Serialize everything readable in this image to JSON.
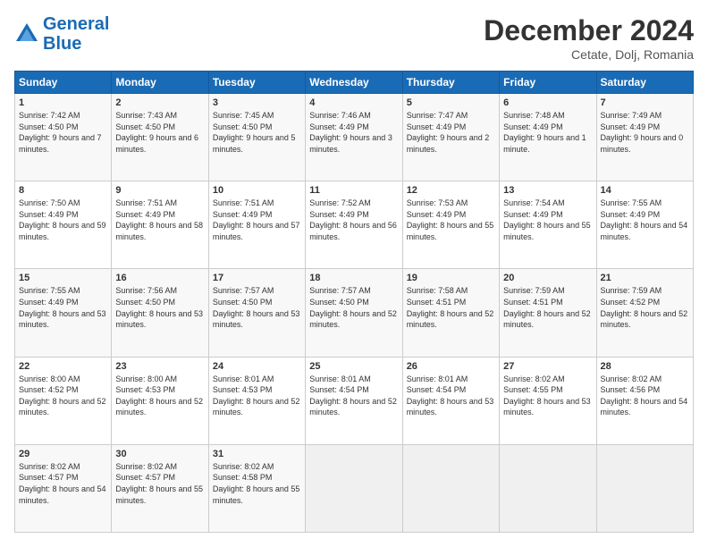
{
  "header": {
    "logo_line1": "General",
    "logo_line2": "Blue",
    "month_year": "December 2024",
    "location": "Cetate, Dolj, Romania"
  },
  "columns": [
    "Sunday",
    "Monday",
    "Tuesday",
    "Wednesday",
    "Thursday",
    "Friday",
    "Saturday"
  ],
  "weeks": [
    [
      {
        "day": "1",
        "sunrise": "Sunrise: 7:42 AM",
        "sunset": "Sunset: 4:50 PM",
        "daylight": "Daylight: 9 hours and 7 minutes."
      },
      {
        "day": "2",
        "sunrise": "Sunrise: 7:43 AM",
        "sunset": "Sunset: 4:50 PM",
        "daylight": "Daylight: 9 hours and 6 minutes."
      },
      {
        "day": "3",
        "sunrise": "Sunrise: 7:45 AM",
        "sunset": "Sunset: 4:50 PM",
        "daylight": "Daylight: 9 hours and 5 minutes."
      },
      {
        "day": "4",
        "sunrise": "Sunrise: 7:46 AM",
        "sunset": "Sunset: 4:49 PM",
        "daylight": "Daylight: 9 hours and 3 minutes."
      },
      {
        "day": "5",
        "sunrise": "Sunrise: 7:47 AM",
        "sunset": "Sunset: 4:49 PM",
        "daylight": "Daylight: 9 hours and 2 minutes."
      },
      {
        "day": "6",
        "sunrise": "Sunrise: 7:48 AM",
        "sunset": "Sunset: 4:49 PM",
        "daylight": "Daylight: 9 hours and 1 minute."
      },
      {
        "day": "7",
        "sunrise": "Sunrise: 7:49 AM",
        "sunset": "Sunset: 4:49 PM",
        "daylight": "Daylight: 9 hours and 0 minutes."
      }
    ],
    [
      {
        "day": "8",
        "sunrise": "Sunrise: 7:50 AM",
        "sunset": "Sunset: 4:49 PM",
        "daylight": "Daylight: 8 hours and 59 minutes."
      },
      {
        "day": "9",
        "sunrise": "Sunrise: 7:51 AM",
        "sunset": "Sunset: 4:49 PM",
        "daylight": "Daylight: 8 hours and 58 minutes."
      },
      {
        "day": "10",
        "sunrise": "Sunrise: 7:51 AM",
        "sunset": "Sunset: 4:49 PM",
        "daylight": "Daylight: 8 hours and 57 minutes."
      },
      {
        "day": "11",
        "sunrise": "Sunrise: 7:52 AM",
        "sunset": "Sunset: 4:49 PM",
        "daylight": "Daylight: 8 hours and 56 minutes."
      },
      {
        "day": "12",
        "sunrise": "Sunrise: 7:53 AM",
        "sunset": "Sunset: 4:49 PM",
        "daylight": "Daylight: 8 hours and 55 minutes."
      },
      {
        "day": "13",
        "sunrise": "Sunrise: 7:54 AM",
        "sunset": "Sunset: 4:49 PM",
        "daylight": "Daylight: 8 hours and 55 minutes."
      },
      {
        "day": "14",
        "sunrise": "Sunrise: 7:55 AM",
        "sunset": "Sunset: 4:49 PM",
        "daylight": "Daylight: 8 hours and 54 minutes."
      }
    ],
    [
      {
        "day": "15",
        "sunrise": "Sunrise: 7:55 AM",
        "sunset": "Sunset: 4:49 PM",
        "daylight": "Daylight: 8 hours and 53 minutes."
      },
      {
        "day": "16",
        "sunrise": "Sunrise: 7:56 AM",
        "sunset": "Sunset: 4:50 PM",
        "daylight": "Daylight: 8 hours and 53 minutes."
      },
      {
        "day": "17",
        "sunrise": "Sunrise: 7:57 AM",
        "sunset": "Sunset: 4:50 PM",
        "daylight": "Daylight: 8 hours and 53 minutes."
      },
      {
        "day": "18",
        "sunrise": "Sunrise: 7:57 AM",
        "sunset": "Sunset: 4:50 PM",
        "daylight": "Daylight: 8 hours and 52 minutes."
      },
      {
        "day": "19",
        "sunrise": "Sunrise: 7:58 AM",
        "sunset": "Sunset: 4:51 PM",
        "daylight": "Daylight: 8 hours and 52 minutes."
      },
      {
        "day": "20",
        "sunrise": "Sunrise: 7:59 AM",
        "sunset": "Sunset: 4:51 PM",
        "daylight": "Daylight: 8 hours and 52 minutes."
      },
      {
        "day": "21",
        "sunrise": "Sunrise: 7:59 AM",
        "sunset": "Sunset: 4:52 PM",
        "daylight": "Daylight: 8 hours and 52 minutes."
      }
    ],
    [
      {
        "day": "22",
        "sunrise": "Sunrise: 8:00 AM",
        "sunset": "Sunset: 4:52 PM",
        "daylight": "Daylight: 8 hours and 52 minutes."
      },
      {
        "day": "23",
        "sunrise": "Sunrise: 8:00 AM",
        "sunset": "Sunset: 4:53 PM",
        "daylight": "Daylight: 8 hours and 52 minutes."
      },
      {
        "day": "24",
        "sunrise": "Sunrise: 8:01 AM",
        "sunset": "Sunset: 4:53 PM",
        "daylight": "Daylight: 8 hours and 52 minutes."
      },
      {
        "day": "25",
        "sunrise": "Sunrise: 8:01 AM",
        "sunset": "Sunset: 4:54 PM",
        "daylight": "Daylight: 8 hours and 52 minutes."
      },
      {
        "day": "26",
        "sunrise": "Sunrise: 8:01 AM",
        "sunset": "Sunset: 4:54 PM",
        "daylight": "Daylight: 8 hours and 53 minutes."
      },
      {
        "day": "27",
        "sunrise": "Sunrise: 8:02 AM",
        "sunset": "Sunset: 4:55 PM",
        "daylight": "Daylight: 8 hours and 53 minutes."
      },
      {
        "day": "28",
        "sunrise": "Sunrise: 8:02 AM",
        "sunset": "Sunset: 4:56 PM",
        "daylight": "Daylight: 8 hours and 54 minutes."
      }
    ],
    [
      {
        "day": "29",
        "sunrise": "Sunrise: 8:02 AM",
        "sunset": "Sunset: 4:57 PM",
        "daylight": "Daylight: 8 hours and 54 minutes."
      },
      {
        "day": "30",
        "sunrise": "Sunrise: 8:02 AM",
        "sunset": "Sunset: 4:57 PM",
        "daylight": "Daylight: 8 hours and 55 minutes."
      },
      {
        "day": "31",
        "sunrise": "Sunrise: 8:02 AM",
        "sunset": "Sunset: 4:58 PM",
        "daylight": "Daylight: 8 hours and 55 minutes."
      },
      null,
      null,
      null,
      null
    ]
  ]
}
